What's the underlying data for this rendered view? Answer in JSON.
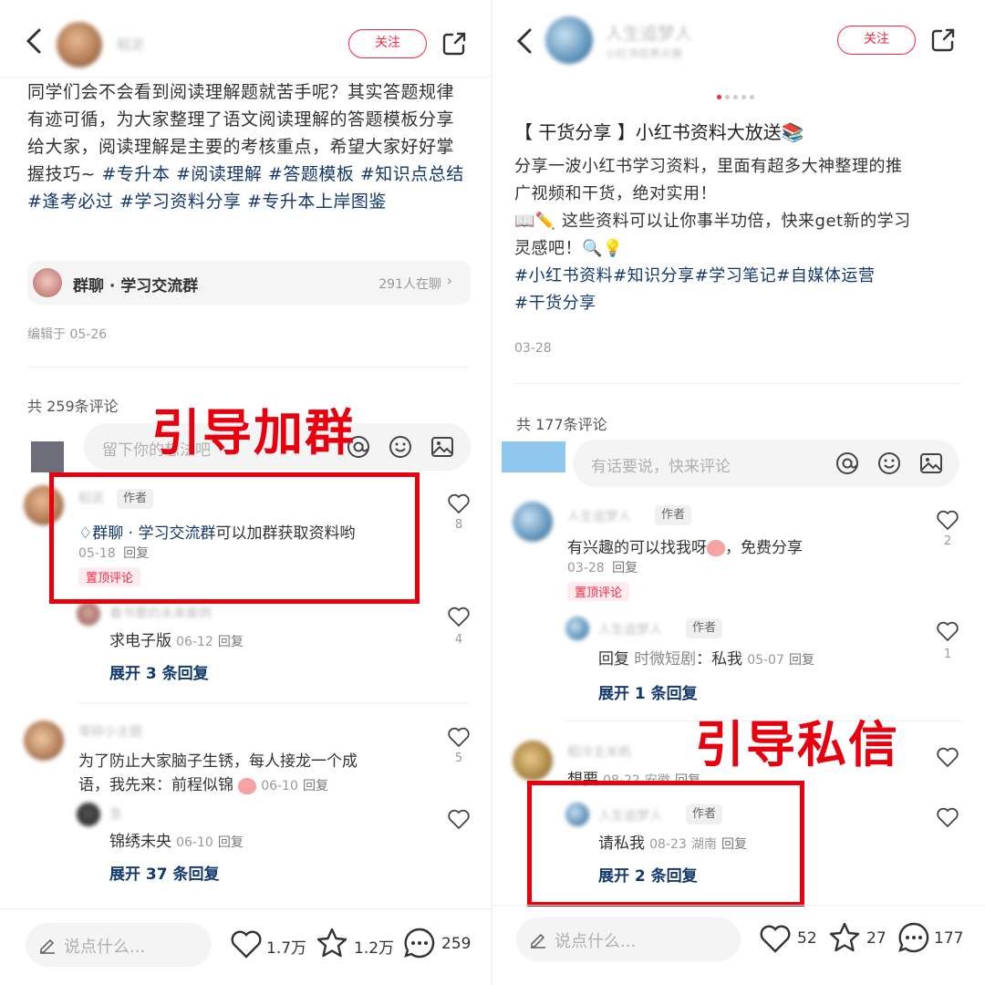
{
  "left": {
    "header": {
      "username": "稻泥",
      "follow_label": "关注"
    },
    "post": {
      "body": "同学们会不会看到阅读理解题就苦手呢？其实答题规律有迹可循，为大家整理了语文阅读理解的答题模板分享给大家，阅读理解是主要的考核重点，希望大家好好掌握技巧~",
      "tags": [
        "#专升本",
        "#阅读理解",
        "#答题模板",
        "#知识点总结",
        "#逢考必过",
        "#学习资料分享",
        "#专升本上岸图鉴"
      ]
    },
    "group_card": {
      "label": "群聊 · 学习交流群",
      "online": "291人在聊"
    },
    "edited": "编辑于 05-26",
    "comment_count": "共 259条评论",
    "comment_input_placeholder": "留下你的想法吧",
    "annotation": "引导加群",
    "comments": [
      {
        "name": "稻泥",
        "badge": "作者",
        "link_text": "群聊 · 学习交流群",
        "text": "可以加群获取资料哟",
        "date": "05-18",
        "reply": "回复",
        "pinned": "置顶评论",
        "likes": "8",
        "replies": [
          {
            "name": "看书要的未来案例",
            "text": "求电子版",
            "date": "06-12",
            "reply": "回复",
            "likes": "4"
          }
        ],
        "expand": "展开 3 条回复"
      },
      {
        "name": "零碎小主题",
        "badge": "",
        "text_line1": "为了防止大家脑子生锈，每人接龙一个成",
        "text_line2": "语，我先来：前程似锦",
        "date": "06-10",
        "reply": "回复",
        "likes": "5",
        "replies": [
          {
            "name": "急",
            "text": "锦绣未央",
            "date": "06-10",
            "reply": "回复",
            "likes": ""
          }
        ],
        "expand": "展开 37 条回复"
      }
    ],
    "bottom_bar": {
      "placeholder": "说点什么...",
      "likes": "1.7万",
      "stars": "1.2万",
      "comments": "259"
    }
  },
  "right": {
    "header": {
      "username": "人生追梦人",
      "subtitle": "小红书优秀大赛",
      "follow_label": "关注"
    },
    "post": {
      "title": "【 干货分享 】小红书资料大放送📚",
      "line1": "分享一波小红书学习资料，里面有超多大神整理的推",
      "line2": "广视频和干货，绝对实用！",
      "line3": "📖✏️ 这些资料可以让你事半功倍，快来get新的学习",
      "line4": "灵感吧！🔍💡",
      "tags": [
        "#小红书资料",
        "#知识分享",
        "#学习笔记",
        "#自媒体运营",
        "#干货分享"
      ]
    },
    "date": "03-28",
    "comment_count": "共 177条评论",
    "comment_input_placeholder": "有话要说，快来评论",
    "annotation": "引导私信",
    "comments": [
      {
        "name": "人生追梦人",
        "badge": "作者",
        "text": "有兴趣的可以找我呀",
        "text_suffix": "，免费分享",
        "date": "03-28",
        "reply": "回复",
        "pinned": "置顶评论",
        "likes": "2",
        "replies": [
          {
            "name": "人生追梦人",
            "badge": "作者",
            "text_prefix": "回复",
            "reply_to": "时微短剧",
            "text": "：私我",
            "date": "05-07",
            "reply": "回复",
            "likes": "1"
          }
        ],
        "expand": "展开 1 条回复"
      },
      {
        "name": "稻冷主米帆",
        "badge": "",
        "text": "想要",
        "date": "08-22",
        "location": "安徽",
        "reply": "回复",
        "likes": "",
        "replies": [
          {
            "name": "人生追梦人",
            "badge": "作者",
            "text": "请私我",
            "date": "08-23",
            "location": "湖南",
            "reply": "回复",
            "likes": ""
          }
        ],
        "expand": "展开 2 条回复"
      }
    ],
    "bottom_bar": {
      "placeholder": "说点什么...",
      "likes": "52",
      "stars": "27",
      "comments": "177"
    }
  },
  "colors": {
    "accent": "#ff2442",
    "tag": "#13386c",
    "annotation": "#e8000f"
  }
}
